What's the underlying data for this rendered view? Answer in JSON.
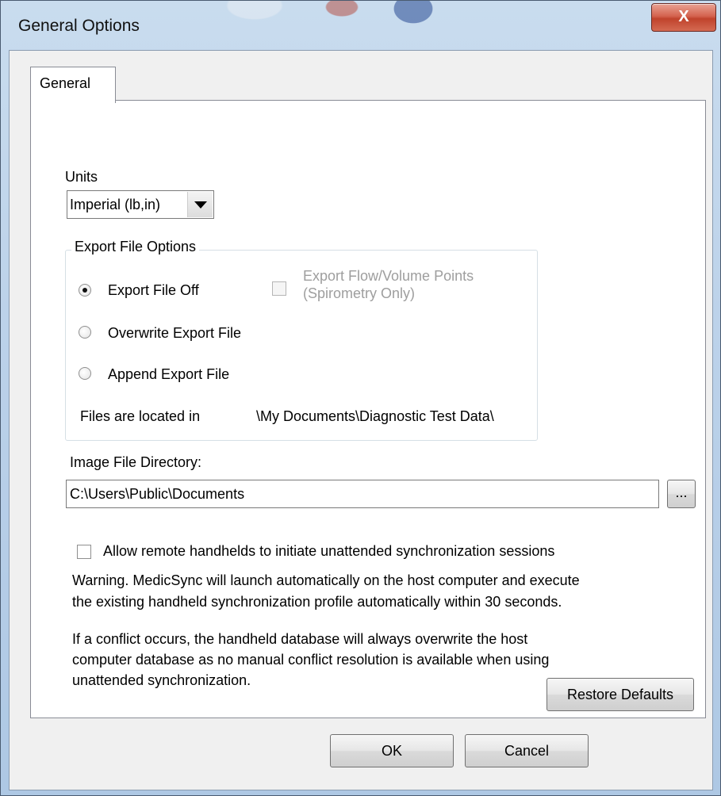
{
  "window": {
    "title": "General Options",
    "close_label": "X"
  },
  "tabs": [
    {
      "label": "General"
    }
  ],
  "units": {
    "label": "Units",
    "selected": "Imperial (lb,in)"
  },
  "export_group": {
    "legend": "Export File Options",
    "options": [
      {
        "label": "Export File Off",
        "selected": true
      },
      {
        "label": "Overwrite Export File",
        "selected": false
      },
      {
        "label": "Append Export File",
        "selected": false
      }
    ],
    "flow_volume": {
      "line1": "Export Flow/Volume Points",
      "line2": "(Spirometry Only)",
      "checked": false,
      "enabled": false
    },
    "location_label": "Files are located in",
    "location_value": "\\My Documents\\Diagnostic Test Data\\"
  },
  "image_dir": {
    "label": "Image File Directory:",
    "value": "C:\\Users\\Public\\Documents",
    "browse_label": "..."
  },
  "remote_sync": {
    "label": "Allow remote handhelds to initiate unattended synchronization sessions",
    "checked": false,
    "warning_line1": "Warning.  MedicSync will launch automatically on the host computer and execute",
    "warning_line2": "the existing handheld synchronization profile automatically within 30 seconds.",
    "conflict_line1": "If a conflict occurs, the handheld database will always overwrite the host",
    "conflict_line2": "computer database as no manual conflict resolution is available when using",
    "conflict_line3": "unattended synchronization."
  },
  "buttons": {
    "restore_defaults": "Restore Defaults",
    "ok": "OK",
    "cancel": "Cancel"
  }
}
